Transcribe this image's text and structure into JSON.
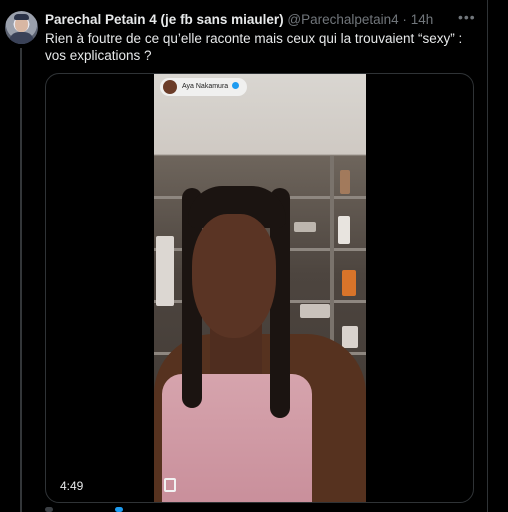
{
  "tweet": {
    "author_name": "Parechal Petain 4 (je fb sans miauler)",
    "handle": "@Parechalpetain4",
    "separator": "·",
    "time": "14h",
    "more_label": "•••",
    "text": "Rien à foutre de ce qu’elle raconte mais ceux qui la trouvaient “sexy” : vos explications ?"
  },
  "media": {
    "badge_name": "Aya Nakamura",
    "duration": "4:49",
    "accent_color": "#1d9bf0"
  },
  "icons": {
    "more": "more-horizontal-icon",
    "verified": "verified-icon",
    "fullscreen": "fullscreen-icon"
  }
}
